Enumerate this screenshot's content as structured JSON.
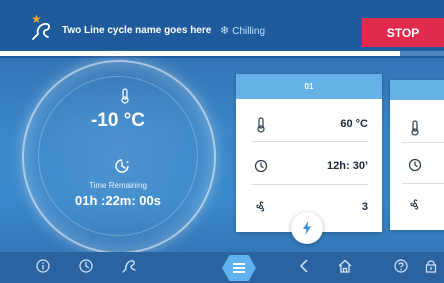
{
  "header": {
    "cycle_name": "Two Line cycle name goes here",
    "status": "Chilling",
    "stop_label": "STOP",
    "progress_fraction": 0.9
  },
  "current": {
    "temperature": "-10 °C",
    "time_label": "Time Remaining",
    "time_value": "01h :22m: 00s"
  },
  "steps": [
    {
      "title": "01",
      "temperature": "60 °C",
      "time": "12h: 30’",
      "fan": "3"
    },
    {
      "title": "",
      "temperature": "",
      "time": "",
      "fan": ""
    }
  ],
  "icons": {
    "cycle": "probe-icon",
    "star": "star-icon",
    "status": "snowflake-icon",
    "bolt": "bolt-icon",
    "nav": [
      "info-icon",
      "clock-icon",
      "probe-icon",
      "menu-icon",
      "back-icon",
      "home-icon",
      "help-icon",
      "lock-icon"
    ]
  },
  "colors": {
    "stop": "#e02b4c",
    "accent": "#5fb2ef",
    "star": "#f5a623",
    "card_header": "#66b1e6"
  }
}
